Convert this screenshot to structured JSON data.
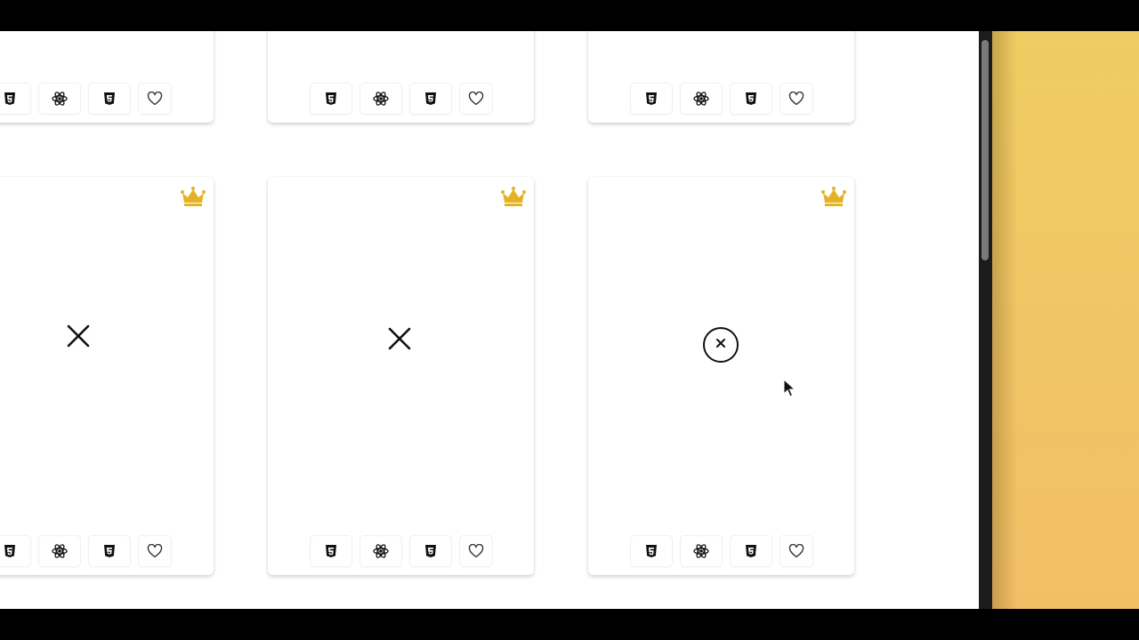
{
  "colors": {
    "crown": "#e3b325",
    "icon": "#111111",
    "wallpaper_top": "#efcd62",
    "wallpaper_bottom": "#f2bf66"
  },
  "card_actions": [
    {
      "name": "html5-icon",
      "kind": "tech"
    },
    {
      "name": "react-icon",
      "kind": "tech"
    },
    {
      "name": "css3-icon",
      "kind": "tech"
    },
    {
      "name": "heart-icon",
      "kind": "favorite"
    }
  ],
  "cards": [
    {
      "row": "top",
      "column": 1,
      "premium": false
    },
    {
      "row": "top",
      "column": 2,
      "premium": false
    },
    {
      "row": "top",
      "column": 3,
      "premium": false
    },
    {
      "row": "bottom",
      "column": 1,
      "premium": true,
      "preview": "x-icon"
    },
    {
      "row": "bottom",
      "column": 2,
      "premium": true,
      "preview": "x-icon"
    },
    {
      "row": "bottom",
      "column": 3,
      "premium": true,
      "preview": "x-circle-icon"
    }
  ]
}
